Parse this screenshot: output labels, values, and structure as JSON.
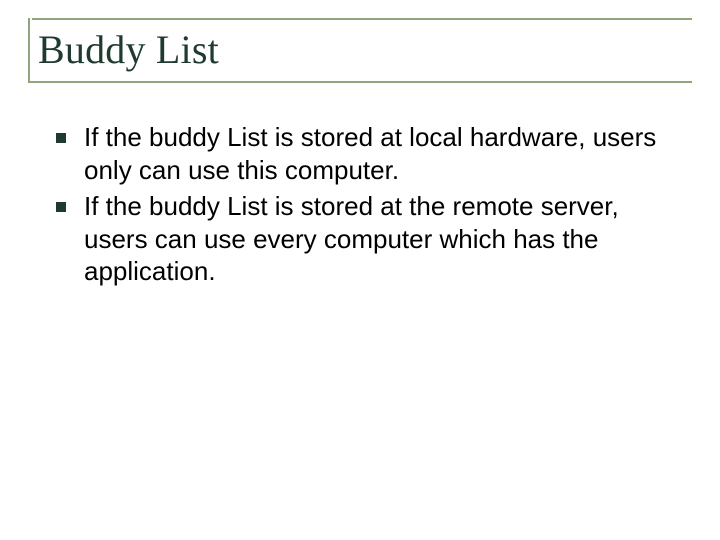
{
  "slide": {
    "title": "Buddy List",
    "bullets": [
      "If the buddy List is stored at local hardware, users only can use this computer.",
      "If the buddy List is stored at the remote server, users can use every computer which has the application."
    ]
  }
}
